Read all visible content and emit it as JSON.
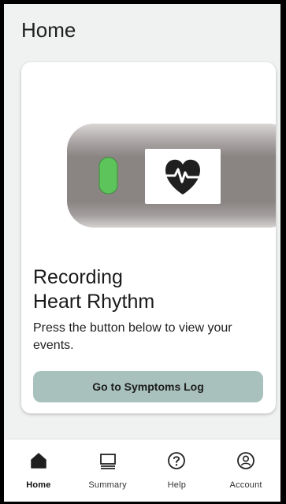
{
  "page": {
    "title": "Home"
  },
  "card": {
    "heading_line1": "Recording",
    "heading_line2": "Heart Rhythm",
    "description": "Press the button below to view your events.",
    "button_label": "Go to Symptoms Log"
  },
  "device": {
    "indicator_color": "#5cc45a",
    "icon": "heart-pulse-icon"
  },
  "nav": {
    "items": [
      {
        "label": "Home",
        "icon": "home-icon",
        "active": true
      },
      {
        "label": "Summary",
        "icon": "monitor-icon",
        "active": false
      },
      {
        "label": "Help",
        "icon": "help-icon",
        "active": false
      },
      {
        "label": "Account",
        "icon": "account-icon",
        "active": false
      }
    ]
  },
  "colors": {
    "background": "#f0f2f1",
    "button": "#a9c1bc",
    "device_body": "#8c8685"
  }
}
